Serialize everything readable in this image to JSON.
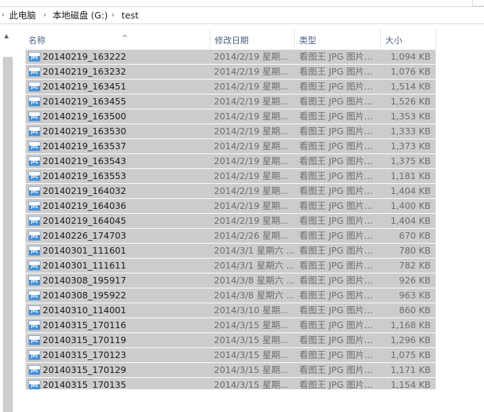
{
  "breadcrumb": [
    "此电脑",
    "本地磁盘 (G:)",
    "test"
  ],
  "columns": {
    "name": "名称",
    "date": "修改日期",
    "type": "类型",
    "size": "大小"
  },
  "icon_text": "JPG",
  "files": [
    {
      "name": "20140219_163222",
      "date": "2014/2/19 星期...",
      "type": "看图王 JPG 图片...",
      "size": "1,094 KB"
    },
    {
      "name": "20140219_163232",
      "date": "2014/2/19 星期...",
      "type": "看图王 JPG 图片...",
      "size": "1,076 KB"
    },
    {
      "name": "20140219_163451",
      "date": "2014/2/19 星期...",
      "type": "看图王 JPG 图片...",
      "size": "1,514 KB"
    },
    {
      "name": "20140219_163455",
      "date": "2014/2/19 星期...",
      "type": "看图王 JPG 图片...",
      "size": "1,526 KB"
    },
    {
      "name": "20140219_163500",
      "date": "2014/2/19 星期...",
      "type": "看图王 JPG 图片...",
      "size": "1,353 KB"
    },
    {
      "name": "20140219_163530",
      "date": "2014/2/19 星期...",
      "type": "看图王 JPG 图片...",
      "size": "1,333 KB"
    },
    {
      "name": "20140219_163537",
      "date": "2014/2/19 星期...",
      "type": "看图王 JPG 图片...",
      "size": "1,373 KB"
    },
    {
      "name": "20140219_163543",
      "date": "2014/2/19 星期...",
      "type": "看图王 JPG 图片...",
      "size": "1,375 KB"
    },
    {
      "name": "20140219_163553",
      "date": "2014/2/19 星期...",
      "type": "看图王 JPG 图片...",
      "size": "1,181 KB"
    },
    {
      "name": "20140219_164032",
      "date": "2014/2/19 星期...",
      "type": "看图王 JPG 图片...",
      "size": "1,404 KB"
    },
    {
      "name": "20140219_164036",
      "date": "2014/2/19 星期...",
      "type": "看图王 JPG 图片...",
      "size": "1,400 KB"
    },
    {
      "name": "20140219_164045",
      "date": "2014/2/19 星期...",
      "type": "看图王 JPG 图片...",
      "size": "1,404 KB"
    },
    {
      "name": "20140226_174703",
      "date": "2014/2/26 星期...",
      "type": "看图王 JPG 图片...",
      "size": "670 KB"
    },
    {
      "name": "20140301_111601",
      "date": "2014/3/1 星期六 ...",
      "type": "看图王 JPG 图片...",
      "size": "780 KB"
    },
    {
      "name": "20140301_111611",
      "date": "2014/3/1 星期六 ...",
      "type": "看图王 JPG 图片...",
      "size": "782 KB"
    },
    {
      "name": "20140308_195917",
      "date": "2014/3/8 星期六 ...",
      "type": "看图王 JPG 图片...",
      "size": "926 KB"
    },
    {
      "name": "20140308_195922",
      "date": "2014/3/8 星期六 ...",
      "type": "看图王 JPG 图片...",
      "size": "963 KB"
    },
    {
      "name": "20140310_114001",
      "date": "2014/3/10 星期...",
      "type": "看图王 JPG 图片...",
      "size": "860 KB"
    },
    {
      "name": "20140315_170116",
      "date": "2014/3/15 星期...",
      "type": "看图王 JPG 图片...",
      "size": "1,168 KB"
    },
    {
      "name": "20140315_170119",
      "date": "2014/3/15 星期...",
      "type": "看图王 JPG 图片...",
      "size": "1,296 KB"
    },
    {
      "name": "20140315_170123",
      "date": "2014/3/15 星期...",
      "type": "看图王 JPG 图片...",
      "size": "1,075 KB"
    },
    {
      "name": "20140315_170129",
      "date": "2014/3/15 星期...",
      "type": "看图王 JPG 图片...",
      "size": "1,171 KB"
    },
    {
      "name": "20140315_170135",
      "date": "2014/3/15 星期...",
      "type": "看图王 JPG 图片...",
      "size": "1,154 KB"
    }
  ]
}
